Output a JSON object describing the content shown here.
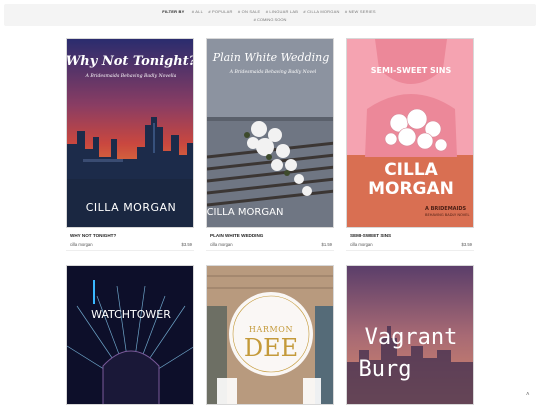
{
  "filter": {
    "label": "FILTER BY",
    "options": [
      "# ALL",
      "# POPULAR",
      "# ON SALE",
      "# LINGUAR LAB",
      "# CILLA MORGAN",
      "# NEW SERIES"
    ],
    "option_row2": "# COMING SOON"
  },
  "books": [
    {
      "title": "WHY NOT TONIGHT?",
      "author": "cilla morgan",
      "price": "$3.59",
      "cover": {
        "title": "Why Not Tonight?",
        "subtitle": "A Bridesmaids Behaving Badly Novella",
        "author": "CILLA MORGAN",
        "colors": {
          "sky_top": "#2a2c6e",
          "sky_mid": "#c9473f",
          "sky_low": "#e0843a",
          "city": "#1c2b4a",
          "text": "#ffffff"
        }
      }
    },
    {
      "title": "PLAIN WHITE WEDDING",
      "author": "cilla morgan",
      "price": "$1.59",
      "cover": {
        "title": "Plain White Wedding",
        "subtitle": "A Bridesmaids Behaving Badly Novel",
        "author": "CILLA MORGAN",
        "colors": {
          "bg": "#6f7683",
          "bench": "#3b3634",
          "flowers": "#f2f2f2",
          "text": "#ffffff"
        }
      }
    },
    {
      "title": "SEMI-SWEET SINS",
      "author": "cilla morgan",
      "price": "$3.59",
      "cover": {
        "title": "SEMI-SWEET SINS",
        "author_line1": "CILLA",
        "author_line2": "MORGAN",
        "series_line1": "A BRIDEMAIDS",
        "series_line2": "BEHAVING BADLY NOVEL",
        "colors": {
          "top": "#f5a3b1",
          "bottom": "#d96f52",
          "dress": "#ec8899",
          "text": "#ffffff",
          "dark": "#4a1e14"
        }
      }
    },
    {
      "title": "",
      "author": "",
      "price": "",
      "cover": {
        "title": "WATCHTOWER",
        "colors": {
          "bg": "#0d0f2a",
          "beam": "#8fd8ff",
          "text": "#ffffff"
        }
      }
    },
    {
      "title": "",
      "author": "",
      "price": "",
      "cover": {
        "title_line1": "HARMON",
        "title_line2": "DEE",
        "colors": {
          "wall": "#b89a7e",
          "door": "#ffffff",
          "gold": "#c49a3a"
        }
      }
    },
    {
      "title": "",
      "author": "",
      "price": "",
      "cover": {
        "title_line1": "Vagrant",
        "title_line2": "Burg",
        "colors": {
          "sky_top": "#5b3e6a",
          "sky_low": "#d88b6b",
          "text": "#ffffff"
        }
      }
    }
  ],
  "scroll_top_icon": "chevron-up-icon",
  "scroll_top_glyph": "˄"
}
